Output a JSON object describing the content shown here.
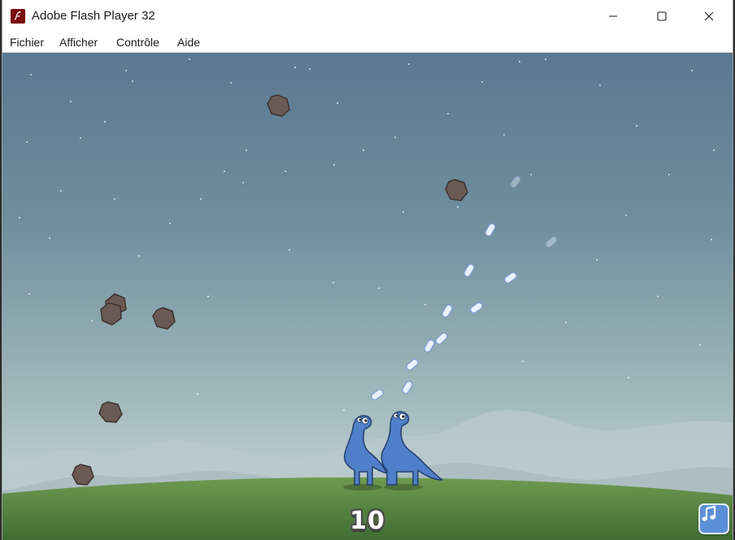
{
  "window": {
    "title": "Adobe Flash Player 32",
    "app_icon": "flash-player-icon",
    "controls": [
      "minimize-icon",
      "maximize-icon",
      "close-icon"
    ]
  },
  "menu": {
    "items": [
      "Fichier",
      "Afficher",
      "Contrôle",
      "Aide"
    ]
  },
  "game": {
    "score": "10",
    "music_button_icon": "music-note-icon",
    "colors": {
      "sky_top": "#5c7b94",
      "sky_bottom": "#c7d6d7",
      "ground": "#5f8845",
      "dino": "#4f7fc8",
      "rock": "#6b5a54",
      "raindrop": "#e8f2ff"
    }
  }
}
